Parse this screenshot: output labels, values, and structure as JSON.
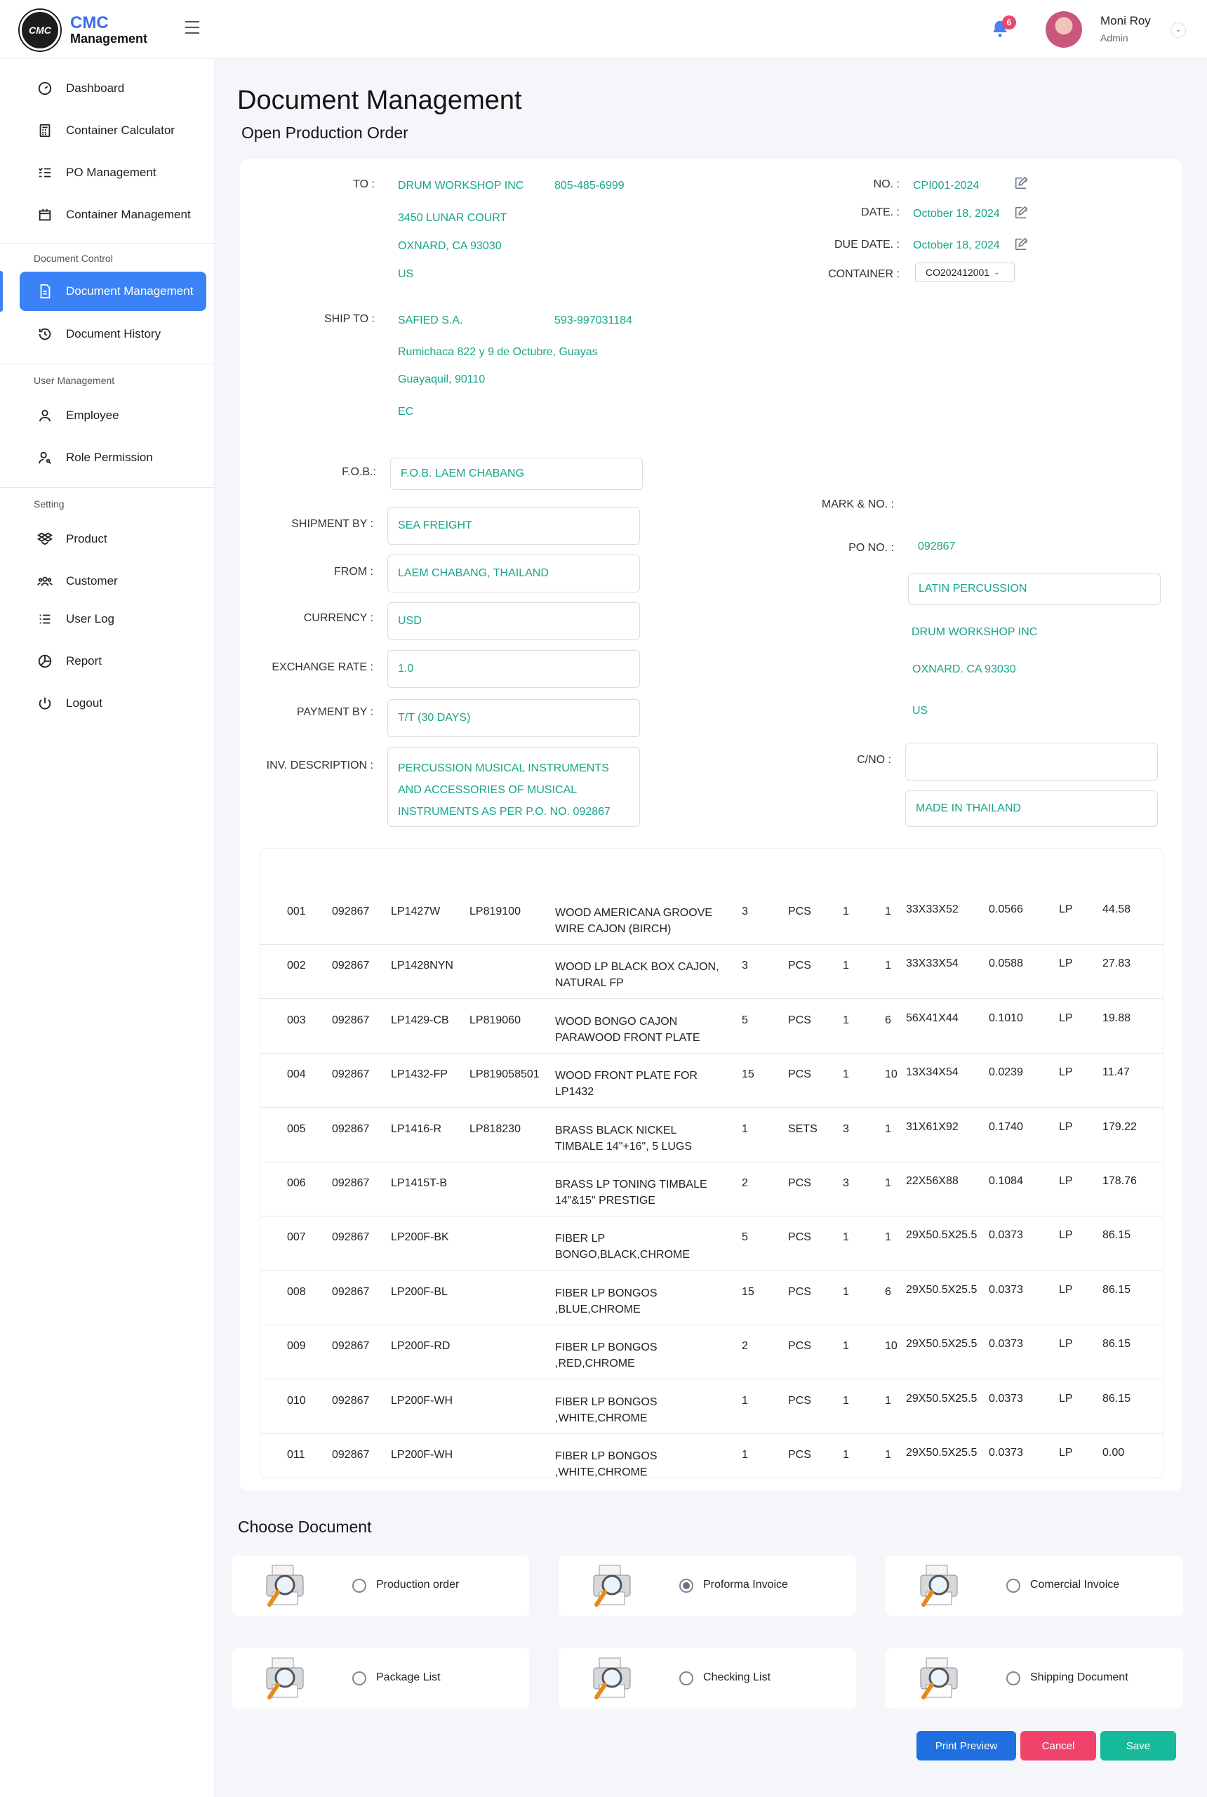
{
  "brand": {
    "line1": "CMC",
    "line2": "Management",
    "logo_text": "CMC"
  },
  "header": {
    "notification_count": "6",
    "user_name": "Moni Roy",
    "user_role": "Admin"
  },
  "sidebar": {
    "items_top": [
      {
        "label": "Dashboard",
        "icon": "gauge-icon"
      },
      {
        "label": "Container Calculator",
        "icon": "calculator-icon"
      },
      {
        "label": "PO Management",
        "icon": "checklist-icon"
      },
      {
        "label": "Container Management",
        "icon": "box-icon"
      }
    ],
    "section_document": "Document Control",
    "items_document": [
      {
        "label": "Document Management",
        "icon": "document-icon",
        "active": true
      },
      {
        "label": "Document History",
        "icon": "history-icon"
      }
    ],
    "section_user": "User Management",
    "items_user": [
      {
        "label": "Employee",
        "icon": "user-icon"
      },
      {
        "label": "Role Permission",
        "icon": "user-key-icon"
      }
    ],
    "section_setting": "Setting",
    "items_setting": [
      {
        "label": "Product",
        "icon": "dropbox-icon"
      },
      {
        "label": "Customer",
        "icon": "group-icon"
      },
      {
        "label": "User Log",
        "icon": "list-icon"
      },
      {
        "label": "Report",
        "icon": "pie-icon"
      },
      {
        "label": "Logout",
        "icon": "power-icon"
      }
    ]
  },
  "page": {
    "title": "Document Management",
    "subtitle": "Open Production Order"
  },
  "form": {
    "to_label": "TO :",
    "to_name": "DRUM WORKSHOP INC",
    "to_phone": "805-485-6999",
    "to_addr1": "3450 LUNAR COURT",
    "to_addr2": "OXNARD, CA 93030",
    "to_country": "US",
    "no_label": "NO. :",
    "no_value": "CPI001-2024",
    "date_label": "DATE. :",
    "date_value": "October 18, 2024",
    "due_label": "DUE DATE. :",
    "due_value": "October 18, 2024",
    "container_label": "CONTAINER :",
    "container_value": "CO202412001",
    "ship_label": "SHIP TO :",
    "ship_name": "SAFIED S.A.",
    "ship_phone": "593-997031184",
    "ship_addr1": "Rumichaca 822 y 9 de Octubre, Guayas",
    "ship_addr2": "Guayaquil, 90110",
    "ship_country": "EC",
    "fob_label": "F.O.B.:",
    "fob_value": "F.O.B. LAEM CHABANG",
    "shipment_label": "SHIPMENT BY :",
    "shipment_value": "SEA FREIGHT",
    "from_label": "FROM :",
    "from_value": "LAEM CHABANG, THAILAND",
    "currency_label": "CURRENCY :",
    "currency_value": "USD",
    "rate_label": "EXCHANGE RATE :",
    "rate_value": "1.0",
    "payment_label": "PAYMENT BY :",
    "payment_value": "T/T (30 DAYS)",
    "inv_label": "INV. DESCRIPTION :",
    "inv_line1": "PERCUSSION MUSICAL INSTRUMENTS",
    "inv_line2": "AND ACCESSORIES OF MUSICAL",
    "inv_line3": "INSTRUMENTS AS PER P.O. NO. 092867",
    "mark_label": "MARK & NO. :",
    "po_label": "PO NO. :",
    "po_value": "092867",
    "mark_input": "LATIN PERCUSSION",
    "mark_line1": "DRUM WORKSHOP INC",
    "mark_line2": "OXNARD. CA 93030",
    "mark_line3": "US",
    "cno_label": "C/NO :",
    "cno_value": "",
    "made_in": "MADE IN THAILAND"
  },
  "table_rows": [
    {
      "no": "001",
      "po": "092867",
      "item": "LP1427W",
      "code": "LP819100",
      "d1": "WOOD AMERICANA GROOVE",
      "d2": "WIRE CAJON (BIRCH)",
      "qty": "3",
      "unit": "PCS",
      "a": "1",
      "b": "1",
      "dim": "33X33X52",
      "cbm": "0.0566",
      "brand": "LP",
      "price": "44.58"
    },
    {
      "no": "002",
      "po": "092867",
      "item": "LP1428NYN",
      "code": "",
      "d1": "WOOD LP BLACK BOX CAJON,",
      "d2": "NATURAL FP",
      "qty": "3",
      "unit": "PCS",
      "a": "1",
      "b": "1",
      "dim": "33X33X54",
      "cbm": "0.0588",
      "brand": "LP",
      "price": "27.83"
    },
    {
      "no": "003",
      "po": "092867",
      "item": "LP1429-CB",
      "code": "LP819060",
      "d1": "WOOD BONGO CAJON",
      "d2": "PARAWOOD FRONT PLATE",
      "qty": "5",
      "unit": "PCS",
      "a": "1",
      "b": "6",
      "dim": "56X41X44",
      "cbm": "0.1010",
      "brand": "LP",
      "price": "19.88"
    },
    {
      "no": "004",
      "po": "092867",
      "item": "LP1432-FP",
      "code": "LP819058501",
      "d1": "WOOD FRONT PLATE FOR",
      "d2": "LP1432",
      "qty": "15",
      "unit": "PCS",
      "a": "1",
      "b": "10",
      "dim": "13X34X54",
      "cbm": "0.0239",
      "brand": "LP",
      "price": "11.47"
    },
    {
      "no": "005",
      "po": "092867",
      "item": "LP1416-R",
      "code": "LP818230",
      "d1": "BRASS BLACK NICKEL",
      "d2": "TIMBALE 14\"+16\", 5 LUGS",
      "qty": "1",
      "unit": "SETS",
      "a": "3",
      "b": "1",
      "dim": "31X61X92",
      "cbm": "0.1740",
      "brand": "LP",
      "price": "179.22"
    },
    {
      "no": "006",
      "po": "092867",
      "item": "LP1415T-B",
      "code": "",
      "d1": "BRASS LP TONING  TIMBALE",
      "d2": "14\"&15\" PRESTIGE",
      "qty": "2",
      "unit": "PCS",
      "a": "3",
      "b": "1",
      "dim": "22X56X88",
      "cbm": "0.1084",
      "brand": "LP",
      "price": "178.76"
    },
    {
      "no": "007",
      "po": "092867",
      "item": "LP200F-BK",
      "code": "",
      "d1": "FIBER LP",
      "d2": "BONGO,BLACK,CHROME",
      "qty": "5",
      "unit": "PCS",
      "a": "1",
      "b": "1",
      "dim": "29X50.5X25.5",
      "cbm": "0.0373",
      "brand": "LP",
      "price": "86.15"
    },
    {
      "no": "008",
      "po": "092867",
      "item": "LP200F-BL",
      "code": "",
      "d1": "FIBER LP BONGOS",
      "d2": ",BLUE,CHROME",
      "qty": "15",
      "unit": "PCS",
      "a": "1",
      "b": "6",
      "dim": "29X50.5X25.5",
      "cbm": "0.0373",
      "brand": "LP",
      "price": "86.15"
    },
    {
      "no": "009",
      "po": "092867",
      "item": "LP200F-RD",
      "code": "",
      "d1": "FIBER LP BONGOS",
      "d2": ",RED,CHROME",
      "qty": "2",
      "unit": "PCS",
      "a": "1",
      "b": "10",
      "dim": "29X50.5X25.5",
      "cbm": "0.0373",
      "brand": "LP",
      "price": "86.15"
    },
    {
      "no": "010",
      "po": "092867",
      "item": "LP200F-WH",
      "code": "",
      "d1": "FIBER LP BONGOS",
      "d2": ",WHITE,CHROME",
      "qty": "1",
      "unit": "PCS",
      "a": "1",
      "b": "1",
      "dim": "29X50.5X25.5",
      "cbm": "0.0373",
      "brand": "LP",
      "price": "86.15"
    },
    {
      "no": "011",
      "po": "092867",
      "item": "LP200F-WH",
      "code": "",
      "d1": "FIBER LP BONGOS",
      "d2": ",WHITE,CHROME",
      "qty": "1",
      "unit": "PCS",
      "a": "1",
      "b": "1",
      "dim": "29X50.5X25.5",
      "cbm": "0.0373",
      "brand": "LP",
      "price": "0.00"
    }
  ],
  "choose": {
    "title": "Choose Document",
    "options": [
      {
        "label": "Production order",
        "selected": false
      },
      {
        "label": "Proforma Invoice",
        "selected": true
      },
      {
        "label": "Comercial Invoice",
        "selected": false
      },
      {
        "label": "Package List",
        "selected": false
      },
      {
        "label": "Checking List",
        "selected": false
      },
      {
        "label": "Shipping Document",
        "selected": false
      }
    ]
  },
  "buttons": {
    "print": "Print Preview",
    "cancel": "Cancel",
    "save": "Save"
  },
  "colors": {
    "accent": "#3b82f6",
    "value_text": "#17a589",
    "cancel": "#f0436c",
    "save": "#16b99a",
    "print": "#1f6fe0"
  }
}
